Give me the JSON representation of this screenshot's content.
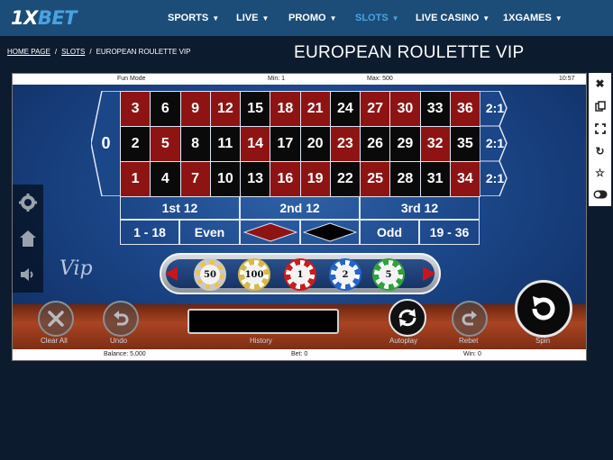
{
  "header": {
    "logo_main": "1X",
    "logo_accent": "BET",
    "nav": [
      {
        "label": "SPORTS",
        "active": false
      },
      {
        "label": "LIVE",
        "active": false
      },
      {
        "label": "PROMO",
        "active": false
      },
      {
        "label": "SLOTS",
        "active": true
      },
      {
        "label": "LIVE CASINO",
        "active": false
      },
      {
        "label": "1XGAMES",
        "active": false
      }
    ]
  },
  "breadcrumb": {
    "home": "HOME PAGE",
    "sep1": "/",
    "slots": "SLOTS",
    "sep2": "/",
    "current": "EUROPEAN ROULETTE VIP"
  },
  "page_title": "EUROPEAN ROULETTE VIP",
  "game": {
    "infobar": {
      "mode": "Fun Mode",
      "min": "Min: 1",
      "max": "Max: 500",
      "time": "10:57"
    },
    "zero": "0",
    "grid_rows": [
      [
        {
          "n": "3",
          "c": "red"
        },
        {
          "n": "6",
          "c": "black"
        },
        {
          "n": "9",
          "c": "red"
        },
        {
          "n": "12",
          "c": "red"
        },
        {
          "n": "15",
          "c": "black"
        },
        {
          "n": "18",
          "c": "red"
        },
        {
          "n": "21",
          "c": "red"
        },
        {
          "n": "24",
          "c": "black"
        },
        {
          "n": "27",
          "c": "red"
        },
        {
          "n": "30",
          "c": "red"
        },
        {
          "n": "33",
          "c": "black"
        },
        {
          "n": "36",
          "c": "red"
        }
      ],
      [
        {
          "n": "2",
          "c": "black"
        },
        {
          "n": "5",
          "c": "red"
        },
        {
          "n": "8",
          "c": "black"
        },
        {
          "n": "11",
          "c": "black"
        },
        {
          "n": "14",
          "c": "red"
        },
        {
          "n": "17",
          "c": "black"
        },
        {
          "n": "20",
          "c": "black"
        },
        {
          "n": "23",
          "c": "red"
        },
        {
          "n": "26",
          "c": "black"
        },
        {
          "n": "29",
          "c": "black"
        },
        {
          "n": "32",
          "c": "red"
        },
        {
          "n": "35",
          "c": "black"
        }
      ],
      [
        {
          "n": "1",
          "c": "red"
        },
        {
          "n": "4",
          "c": "black"
        },
        {
          "n": "7",
          "c": "red"
        },
        {
          "n": "10",
          "c": "black"
        },
        {
          "n": "13",
          "c": "black"
        },
        {
          "n": "16",
          "c": "red"
        },
        {
          "n": "19",
          "c": "red"
        },
        {
          "n": "22",
          "c": "black"
        },
        {
          "n": "25",
          "c": "red"
        },
        {
          "n": "28",
          "c": "black"
        },
        {
          "n": "31",
          "c": "black"
        },
        {
          "n": "34",
          "c": "red"
        }
      ]
    ],
    "column_bets": [
      "2:1",
      "2:1",
      "2:1"
    ],
    "dozens": [
      "1st 12",
      "2nd 12",
      "3rd 12"
    ],
    "outside": {
      "low": "1 - 18",
      "even": "Even",
      "odd": "Odd",
      "high": "19 - 36"
    },
    "chips": [
      {
        "value": "50",
        "color": "#c9c9c9",
        "ring": "#f0c24a"
      },
      {
        "value": "100",
        "color": "#d9b84a",
        "ring": "#ffffff"
      },
      {
        "value": "1",
        "color": "#c81e1e",
        "ring": "#ffffff"
      },
      {
        "value": "2",
        "color": "#2466c9",
        "ring": "#ffffff"
      },
      {
        "value": "5",
        "color": "#2ea33c",
        "ring": "#ffffff"
      }
    ],
    "vip": "Vip",
    "controls": {
      "clear_all": "Clear All",
      "undo": "Undo",
      "history": "History",
      "autoplay": "Autoplay",
      "rebet": "Rebet",
      "spin": "Spin"
    },
    "bottombar": {
      "balance": "Balance: 5,000",
      "bet": "Bet: 0",
      "win": "Win: 0"
    }
  },
  "right_tools": [
    "close-icon",
    "copy-icon",
    "fullscreen-icon",
    "refresh-icon",
    "star-icon",
    "toggle-icon"
  ],
  "colors": {
    "nav_bg": "#1c4d78",
    "accent": "#48a3e3",
    "red_number": "#8e1414",
    "table_blue": "#1b4688"
  }
}
